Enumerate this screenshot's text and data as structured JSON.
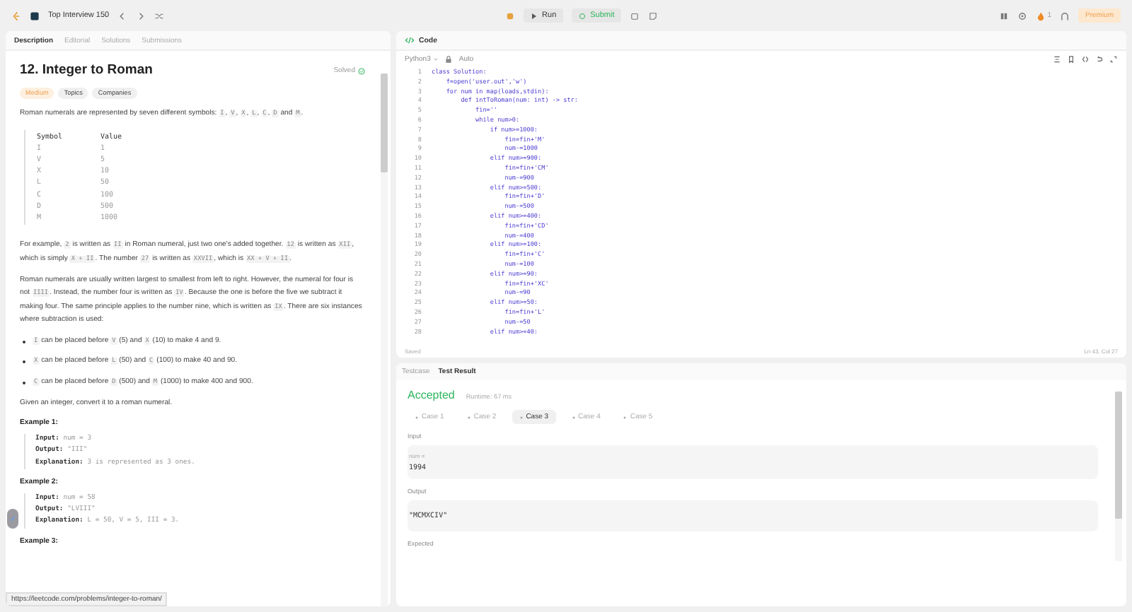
{
  "topbar": {
    "list_title": "Top Interview 150",
    "run": "Run",
    "submit": "Submit",
    "streak": "1",
    "premium": "Premium"
  },
  "left": {
    "tabs": [
      {
        "label": "Description",
        "selected": true
      },
      {
        "label": "Editorial",
        "selected": false
      },
      {
        "label": "Solutions",
        "selected": false
      },
      {
        "label": "Submissions",
        "selected": false
      }
    ],
    "title": "12. Integer to Roman",
    "status": "Solved",
    "difficulty": "Medium",
    "tags": [
      "Topics",
      "Companies"
    ],
    "intro": [
      {
        "kind": "text",
        "text": "Roman numerals are represented by seven different symbols: "
      },
      {
        "kind": "code",
        "text": "I"
      },
      {
        "kind": "text",
        "text": ", "
      },
      {
        "kind": "code",
        "text": "V"
      },
      {
        "kind": "text",
        "text": ", "
      },
      {
        "kind": "code",
        "text": "X"
      },
      {
        "kind": "text",
        "text": ", "
      },
      {
        "kind": "code",
        "text": "L"
      },
      {
        "kind": "text",
        "text": ", "
      },
      {
        "kind": "code",
        "text": "C"
      },
      {
        "kind": "text",
        "text": ", "
      },
      {
        "kind": "code",
        "text": "D"
      },
      {
        "kind": "text",
        "text": " and "
      },
      {
        "kind": "code",
        "text": "M"
      },
      {
        "kind": "text",
        "text": "."
      }
    ],
    "table": {
      "columns": [
        "Symbol",
        "Value"
      ],
      "rows": [
        [
          "I",
          "1"
        ],
        [
          "V",
          "5"
        ],
        [
          "X",
          "10"
        ],
        [
          "L",
          "50"
        ],
        [
          "C",
          "100"
        ],
        [
          "D",
          "500"
        ],
        [
          "M",
          "1000"
        ]
      ]
    },
    "paragraphs": [
      [
        {
          "kind": "text",
          "text": "For example, "
        },
        {
          "kind": "code",
          "text": "2"
        },
        {
          "kind": "text",
          "text": " is written as "
        },
        {
          "kind": "code",
          "text": "II"
        },
        {
          "kind": "text",
          "text": " in Roman numeral, just two one's added together. "
        },
        {
          "kind": "code",
          "text": "12"
        },
        {
          "kind": "text",
          "text": " is written as "
        },
        {
          "kind": "code",
          "text": "XII"
        },
        {
          "kind": "text",
          "text": ", which is simply "
        },
        {
          "kind": "code",
          "text": "X + II"
        },
        {
          "kind": "text",
          "text": ". The number "
        },
        {
          "kind": "code",
          "text": "27"
        },
        {
          "kind": "text",
          "text": " is written as "
        },
        {
          "kind": "code",
          "text": "XXVII"
        },
        {
          "kind": "text",
          "text": ", which is "
        },
        {
          "kind": "code",
          "text": "XX + V + II"
        },
        {
          "kind": "text",
          "text": "."
        }
      ],
      [
        {
          "kind": "text",
          "text": "Roman numerals are usually written largest to smallest from left to right. However, the numeral for four is not "
        },
        {
          "kind": "code",
          "text": "IIII"
        },
        {
          "kind": "text",
          "text": ". Instead, the number four is written as "
        },
        {
          "kind": "code",
          "text": "IV"
        },
        {
          "kind": "text",
          "text": ". Because the one is before the five we subtract it making four. The same principle applies to the number nine, which is written as "
        },
        {
          "kind": "code",
          "text": "IX"
        },
        {
          "kind": "text",
          "text": ". There are six instances where subtraction is used:"
        }
      ]
    ],
    "bullets": [
      [
        {
          "kind": "code",
          "text": "I"
        },
        {
          "kind": "text",
          "text": " can be placed before "
        },
        {
          "kind": "code",
          "text": "V"
        },
        {
          "kind": "text",
          "text": " (5) and "
        },
        {
          "kind": "code",
          "text": "X"
        },
        {
          "kind": "text",
          "text": " (10) to make 4 and 9."
        }
      ],
      [
        {
          "kind": "code",
          "text": "X"
        },
        {
          "kind": "text",
          "text": " can be placed before "
        },
        {
          "kind": "code",
          "text": "L"
        },
        {
          "kind": "text",
          "text": " (50) and "
        },
        {
          "kind": "code",
          "text": "C"
        },
        {
          "kind": "text",
          "text": " (100) to make 40 and 90."
        }
      ],
      [
        {
          "kind": "code",
          "text": "C"
        },
        {
          "kind": "text",
          "text": " can be placed before "
        },
        {
          "kind": "code",
          "text": "D"
        },
        {
          "kind": "text",
          "text": " (500) and "
        },
        {
          "kind": "code",
          "text": "M"
        },
        {
          "kind": "text",
          "text": " (1000) to make 400 and 900."
        }
      ]
    ],
    "closing": "Given an integer, convert it to a roman numeral.",
    "examples": [
      {
        "heading": "Example 1:",
        "lines": [
          {
            "label": "Input:",
            "value": "num = 3"
          },
          {
            "label": "Output:",
            "value": "\"III\""
          },
          {
            "label": "Explanation:",
            "value": "3 is represented as 3 ones."
          }
        ]
      },
      {
        "heading": "Example 2:",
        "lines": [
          {
            "label": "Input:",
            "value": "num = 58"
          },
          {
            "label": "Output:",
            "value": "\"LVIII\""
          },
          {
            "label": "Explanation:",
            "value": "L = 50, V = 5, III = 3."
          }
        ]
      },
      {
        "heading": "Example 3:"
      }
    ],
    "status_url": "https://leetcode.com/problems/integer-to-roman/"
  },
  "code": {
    "title": "Code",
    "language": "Python3",
    "mode": "Auto",
    "lines": [
      "class Solution:",
      "    f=open('user.out','w')",
      "    for num in map(loads,stdin):",
      "        def intToRoman(num: int) -> str:",
      "            fin=''",
      "            while num>0:",
      "                if num>=1000:",
      "                    fin=fin+'M'",
      "                    num-=1000",
      "                elif num>=900:",
      "                    fin=fin+'CM'",
      "                    num-=900",
      "                elif num>=500:",
      "                    fin=fin+'D'",
      "                    num-=500",
      "                elif num>=400:",
      "                    fin=fin+'CD'",
      "                    num-=400",
      "                elif num>=100:",
      "                    fin=fin+'C'",
      "                    num-=100",
      "                elif num>=90:",
      "                    fin=fin+'XC'",
      "                    num-=90",
      "                elif num>=50:",
      "                    fin=fin+'L'",
      "                    num-=50",
      "                elif num>=40:"
    ],
    "line_numbers": [
      "1",
      "2",
      "3",
      "4",
      "5",
      "6",
      "7",
      "8",
      "9",
      "10",
      "11",
      "12",
      "13",
      "14",
      "15",
      "16",
      "17",
      "18",
      "19",
      "20",
      "21",
      "22",
      "23",
      "24",
      "25",
      "26",
      "27",
      "28"
    ],
    "saved": "Saved",
    "cursor": "Ln 43, Col 27"
  },
  "result": {
    "tabs": [
      {
        "label": "Testcase",
        "selected": false
      },
      {
        "label": "Test Result",
        "selected": true
      }
    ],
    "verdict": "Accepted",
    "runtime": "Runtime: 67 ms",
    "cases": [
      {
        "label": "Case 1",
        "selected": false
      },
      {
        "label": "Case 2",
        "selected": false
      },
      {
        "label": "Case 3",
        "selected": true
      },
      {
        "label": "Case 4",
        "selected": false
      },
      {
        "label": "Case 5",
        "selected": false
      }
    ],
    "input_label": "Input",
    "param": "num =",
    "input_value": "1994",
    "output_label": "Output",
    "output_value": "\"MCMXCIV\"",
    "expected_label": "Expected"
  }
}
